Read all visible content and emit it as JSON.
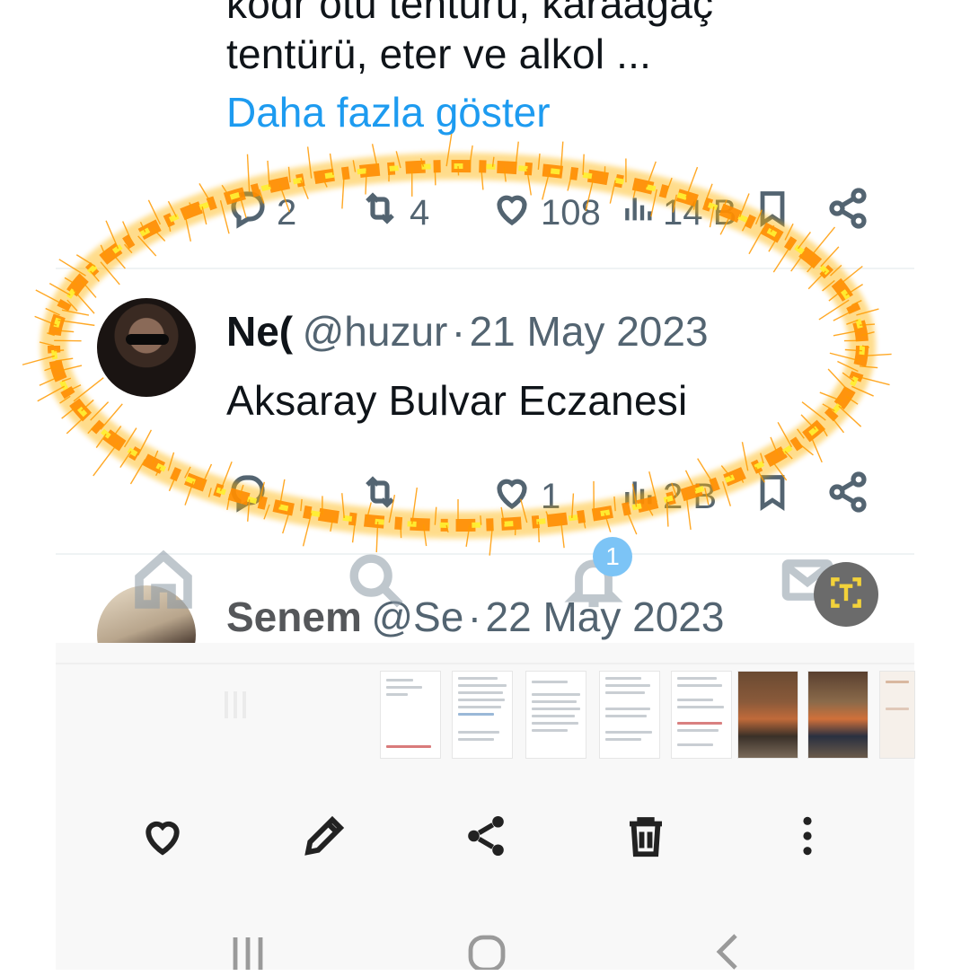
{
  "tweet1": {
    "text_line1": "kodr otu tentürü, karaağaç",
    "text_line2": "tentürü, eter ve alkol ...",
    "show_more": "Daha fazla göster",
    "replies": "2",
    "reposts": "4",
    "likes": "108",
    "views": "14 B"
  },
  "tweet2": {
    "name": "Ne(",
    "handle": "@huzur",
    "dot": "·",
    "date": "21 May 2023",
    "text": "Aksaray Bulvar Eczanesi",
    "likes": "1",
    "views": "2 B"
  },
  "tweet3": {
    "name": "Senem",
    "handle": "@Se",
    "dot": "·",
    "date": "22 May 2023"
  },
  "bottom_nav": {
    "notification_badge": "1"
  },
  "colors": {
    "accent": "#1d9bf0",
    "text": "#0f1419",
    "muted": "#536471",
    "annotation": "#ff9a00"
  },
  "icons": [
    "reply-icon",
    "repost-icon",
    "like-icon",
    "views-icon",
    "bookmark-icon",
    "share-icon",
    "home-icon",
    "search-icon",
    "bell-icon",
    "mail-icon",
    "text-scan-icon",
    "heart-icon",
    "edit-icon",
    "share-icon",
    "trash-icon",
    "more-icon"
  ]
}
